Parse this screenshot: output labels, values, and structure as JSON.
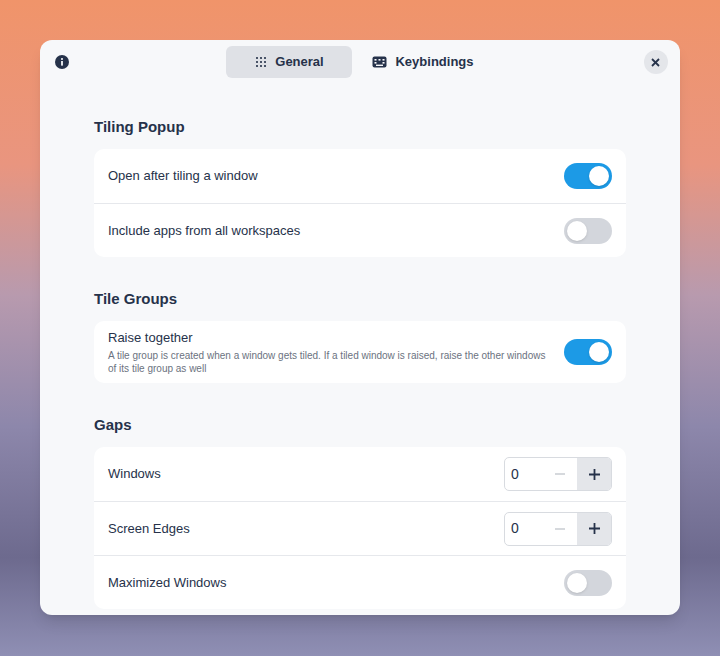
{
  "tabs": [
    {
      "label": "General",
      "selected": true,
      "icon": "grid"
    },
    {
      "label": "Keybindings",
      "selected": false,
      "icon": "keyboard"
    }
  ],
  "sections": [
    {
      "title": "Tiling Popup",
      "rows": [
        {
          "kind": "toggle",
          "label": "Open after tiling a window",
          "on": true
        },
        {
          "kind": "toggle",
          "label": "Include apps from all workspaces",
          "on": false
        }
      ]
    },
    {
      "title": "Tile Groups",
      "rows": [
        {
          "kind": "toggle",
          "label": "Raise together",
          "description": "A tile group is created when a window gets tiled. If a tiled window is raised, raise the other windows of its tile group as well",
          "on": true
        }
      ]
    },
    {
      "title": "Gaps",
      "rows": [
        {
          "kind": "spin",
          "label": "Windows",
          "value": "0",
          "decrement_disabled": true
        },
        {
          "kind": "spin",
          "label": "Screen Edges",
          "value": "0",
          "decrement_disabled": true
        },
        {
          "kind": "toggle",
          "label": "Maximized Windows",
          "on": false
        }
      ]
    }
  ]
}
